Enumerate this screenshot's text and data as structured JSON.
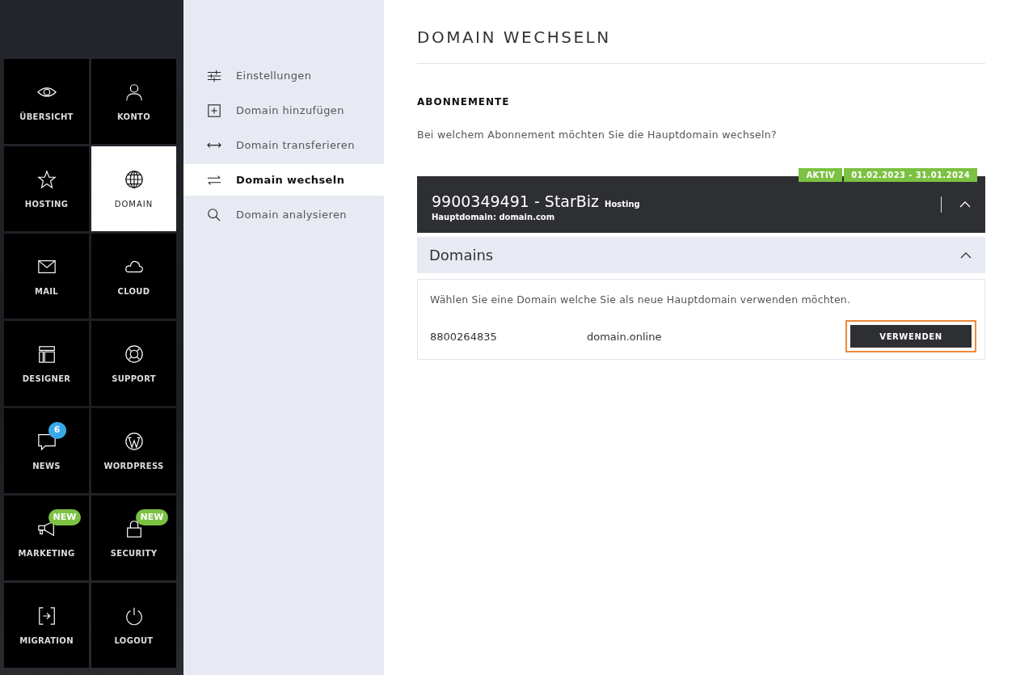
{
  "tiles": [
    {
      "label": "ÜBERSICHT",
      "selected": false
    },
    {
      "label": "KONTO",
      "selected": false
    },
    {
      "label": "HOSTING",
      "selected": false
    },
    {
      "label": "DOMAIN",
      "selected": true
    },
    {
      "label": "MAIL",
      "selected": false
    },
    {
      "label": "CLOUD",
      "selected": false
    },
    {
      "label": "DESIGNER",
      "selected": false
    },
    {
      "label": "SUPPORT",
      "selected": false
    },
    {
      "label": "NEWS",
      "selected": false,
      "badge": {
        "kind": "count",
        "text": "6"
      }
    },
    {
      "label": "WORDPRESS",
      "selected": false
    },
    {
      "label": "MARKETING",
      "selected": false,
      "badge": {
        "kind": "new",
        "text": "NEW"
      }
    },
    {
      "label": "SECURITY",
      "selected": false,
      "badge": {
        "kind": "new",
        "text": "NEW"
      }
    },
    {
      "label": "MIGRATION",
      "selected": false
    },
    {
      "label": "LOGOUT",
      "selected": false
    }
  ],
  "submenu": [
    {
      "label": "Einstellungen",
      "selected": false
    },
    {
      "label": "Domain hinzufügen",
      "selected": false
    },
    {
      "label": "Domain transferieren",
      "selected": false
    },
    {
      "label": "Domain wechseln",
      "selected": true
    },
    {
      "label": "Domain analysieren",
      "selected": false
    }
  ],
  "page_title": "DOMAIN WECHSELN",
  "section_title": "ABONNEMENTE",
  "question": "Bei welchem Abonnement möchten Sie die Hauptdomain wechseln?",
  "subscription": {
    "status": "AKTIV",
    "period": "01.02.2023 - 31.01.2024",
    "title": "9900349491 - StarBiz",
    "type": "Hosting",
    "main_domain": "Hauptdomain: domain.com",
    "expanded": true
  },
  "domains_panel": {
    "title": "Domains",
    "expanded": true,
    "hint": "Wählen Sie eine Domain welche Sie als neue Hauptdomain verwenden möchten.",
    "rows": [
      {
        "id": "8800264835",
        "domain": "domain.online",
        "button": "VERWENDEN",
        "highlighted": true
      }
    ]
  }
}
